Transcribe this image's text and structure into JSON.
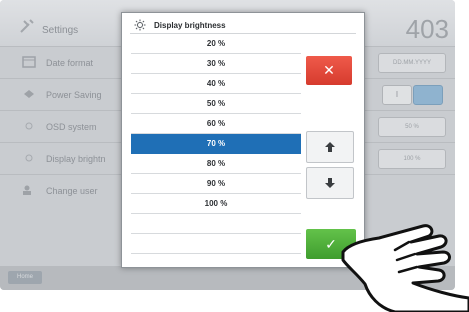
{
  "background": {
    "title": "Settings",
    "counter": "403",
    "rows": [
      {
        "label": "Date format",
        "value": "DD.MM.YYYY"
      },
      {
        "label": "Power Saving",
        "toggle": "I"
      },
      {
        "label": "OSD system",
        "value": "50 %"
      },
      {
        "label": "Display brightn",
        "value": "100 %"
      },
      {
        "label": "Change user",
        "value": ""
      }
    ],
    "home_label": "Home"
  },
  "modal": {
    "title": "Display brightness",
    "title_icon": "sun-icon",
    "options": [
      "20 %",
      "30 %",
      "40 %",
      "50 %",
      "60 %",
      "70 %",
      "80 %",
      "90 %",
      "100 %"
    ],
    "selected": "70 %",
    "cancel_glyph": "✕",
    "confirm_glyph": "✓"
  },
  "colors": {
    "selected_row": "#1f6fb6",
    "cancel": "#d63b2e",
    "confirm": "#3f9d2e"
  }
}
